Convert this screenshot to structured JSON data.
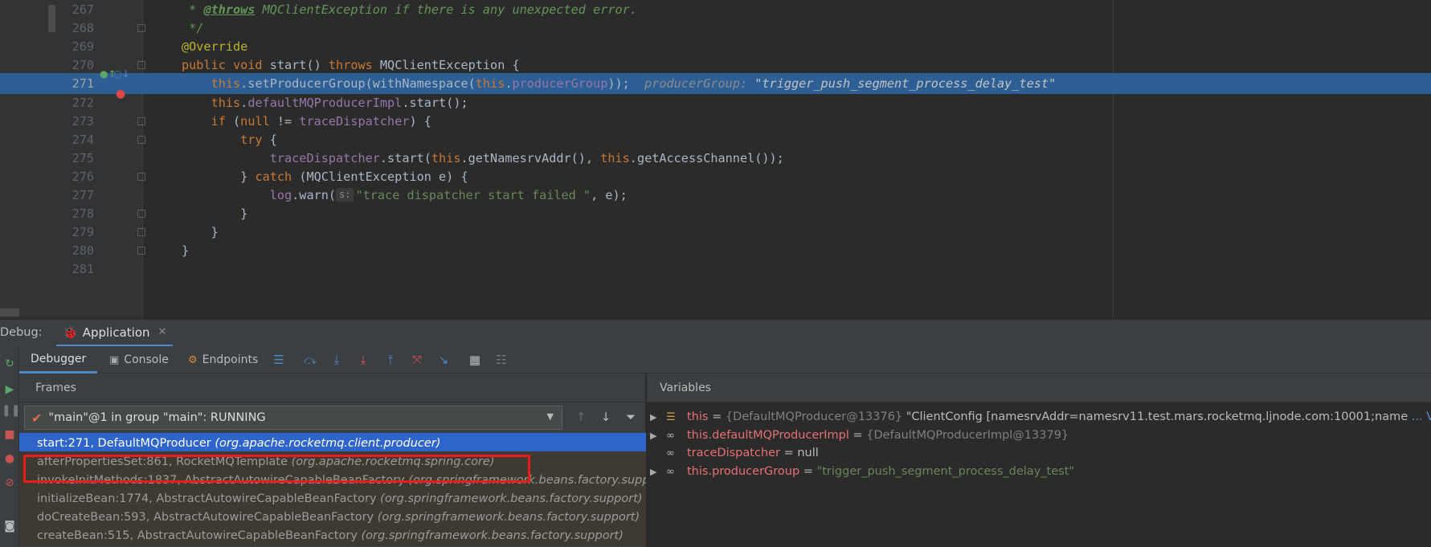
{
  "editor": {
    "lines": [
      {
        "num": "267",
        "tokens": [
          {
            "t": " * ",
            "c": "cm"
          },
          {
            "t": "@throws",
            "c": "cmt"
          },
          {
            "t": " MQClientException",
            "c": "cm"
          },
          {
            "t": " if there is any unexpected error.",
            "c": "cm"
          }
        ]
      },
      {
        "num": "268",
        "tokens": [
          {
            "t": " */",
            "c": "cm"
          }
        ]
      },
      {
        "num": "269",
        "tokens": [
          {
            "t": "@Override",
            "c": "ann"
          }
        ]
      },
      {
        "num": "270",
        "tokens": [
          {
            "t": "public void ",
            "c": "kw"
          },
          {
            "t": "start",
            "c": ""
          },
          {
            "t": "() ",
            "c": ""
          },
          {
            "t": "throws ",
            "c": "kw"
          },
          {
            "t": "MQClientException {",
            "c": ""
          }
        ]
      },
      {
        "num": "271",
        "current": true,
        "tokens": [
          {
            "t": "    this",
            "c": "kw"
          },
          {
            "t": ".setProducerGroup(withNamespace(",
            "c": ""
          },
          {
            "t": "this",
            "c": "kw"
          },
          {
            "t": ".",
            "c": ""
          },
          {
            "t": "producerGroup",
            "c": "fld"
          },
          {
            "t": "));",
            "c": ""
          },
          {
            "t": "  producerGroup: ",
            "c": "hint"
          },
          {
            "t": "\"trigger_push_segment_process_delay_test\"",
            "c": "hintv"
          }
        ]
      },
      {
        "num": "272",
        "tokens": [
          {
            "t": "    this",
            "c": "kw"
          },
          {
            "t": ".",
            "c": ""
          },
          {
            "t": "defaultMQProducerImpl",
            "c": "fld"
          },
          {
            "t": ".start();",
            "c": ""
          }
        ]
      },
      {
        "num": "273",
        "tokens": [
          {
            "t": "    if ",
            "c": "kw"
          },
          {
            "t": "(",
            "c": ""
          },
          {
            "t": "null ",
            "c": "kw"
          },
          {
            "t": "!= ",
            "c": ""
          },
          {
            "t": "traceDispatcher",
            "c": "fld"
          },
          {
            "t": ") {",
            "c": ""
          }
        ]
      },
      {
        "num": "274",
        "tokens": [
          {
            "t": "        try ",
            "c": "kw"
          },
          {
            "t": "{",
            "c": ""
          }
        ]
      },
      {
        "num": "275",
        "tokens": [
          {
            "t": "            traceDispatcher",
            "c": "fld"
          },
          {
            "t": ".start(",
            "c": ""
          },
          {
            "t": "this",
            "c": "kw"
          },
          {
            "t": ".getNamesrvAddr(), ",
            "c": ""
          },
          {
            "t": "this",
            "c": "kw"
          },
          {
            "t": ".getAccessChannel());",
            "c": ""
          }
        ]
      },
      {
        "num": "276",
        "tokens": [
          {
            "t": "        } ",
            "c": ""
          },
          {
            "t": "catch ",
            "c": "kw"
          },
          {
            "t": "(MQClientException e) {",
            "c": ""
          }
        ]
      },
      {
        "num": "277",
        "tokens": [
          {
            "t": "            log",
            "c": "fld"
          },
          {
            "t": ".warn(",
            "c": ""
          },
          {
            "t": "s:",
            "c": "phint"
          },
          {
            "t": "\"trace dispatcher start failed \"",
            "c": "str"
          },
          {
            "t": ", e);",
            "c": ""
          }
        ]
      },
      {
        "num": "278",
        "tokens": [
          {
            "t": "        }",
            "c": ""
          }
        ]
      },
      {
        "num": "279",
        "tokens": [
          {
            "t": "    }",
            "c": ""
          }
        ]
      },
      {
        "num": "280",
        "tokens": [
          {
            "t": "}",
            "c": ""
          }
        ]
      },
      {
        "num": "281",
        "tokens": []
      }
    ]
  },
  "debug": {
    "label": "Debug:",
    "session_tab": "Application",
    "tabs": {
      "debugger": "Debugger",
      "console": "Console",
      "endpoints": "Endpoints"
    },
    "frames_title": "Frames",
    "thread": "\"main\"@1 in group \"main\": RUNNING",
    "frames": [
      {
        "method": "start:271, DefaultMQProducer ",
        "pkg": "(org.apache.rocketmq.client.producer)",
        "state": "sel"
      },
      {
        "method": "afterPropertiesSet:861, RocketMQTemplate ",
        "pkg": "(org.apache.rocketmq.spring.core)",
        "state": "lib"
      },
      {
        "method": "invokeInitMethods:1837, AbstractAutowireCapableBeanFactory ",
        "pkg": "(org.springframework.beans.factory.support)",
        "state": "lib"
      },
      {
        "method": "initializeBean:1774, AbstractAutowireCapableBeanFactory ",
        "pkg": "(org.springframework.beans.factory.support)",
        "state": "lib"
      },
      {
        "method": "doCreateBean:593, AbstractAutowireCapableBeanFactory ",
        "pkg": "(org.springframework.beans.factory.support)",
        "state": "lib"
      },
      {
        "method": "createBean:515, AbstractAutowireCapableBeanFactory ",
        "pkg": "(org.springframework.beans.factory.support)",
        "state": "lib"
      }
    ],
    "variables_title": "Variables",
    "variables": [
      {
        "name": "this",
        "eq": " = ",
        "type": "{DefaultMQProducer@13376} ",
        "value": "\"ClientConfig [namesrvAddr=namesrv11.test.mars.rocketmq.ljnode.com:10001;name ",
        "view": "... View",
        "icon": "field-list-icon",
        "expandable": true
      },
      {
        "name": "this.defaultMQProducerImpl",
        "eq": " = ",
        "type": "{DefaultMQProducerImpl@13379}",
        "value": "",
        "view": "",
        "icon": "watch-glasses-icon",
        "expandable": true
      },
      {
        "name": "traceDispatcher",
        "eq": " = null",
        "type": "",
        "value": "",
        "view": "",
        "icon": "watch-glasses-icon",
        "expandable": false
      },
      {
        "name": "this.producerGroup",
        "eq": " = ",
        "type": "",
        "value": "\"trigger_push_segment_process_delay_test\"",
        "view": "",
        "icon": "watch-glasses-icon",
        "expandable": true
      }
    ]
  },
  "colors": {
    "accent": "#4a88c7",
    "selection": "#2f65ca",
    "current_line": "#2d5e94",
    "highlight_box": "#e81c1c"
  }
}
